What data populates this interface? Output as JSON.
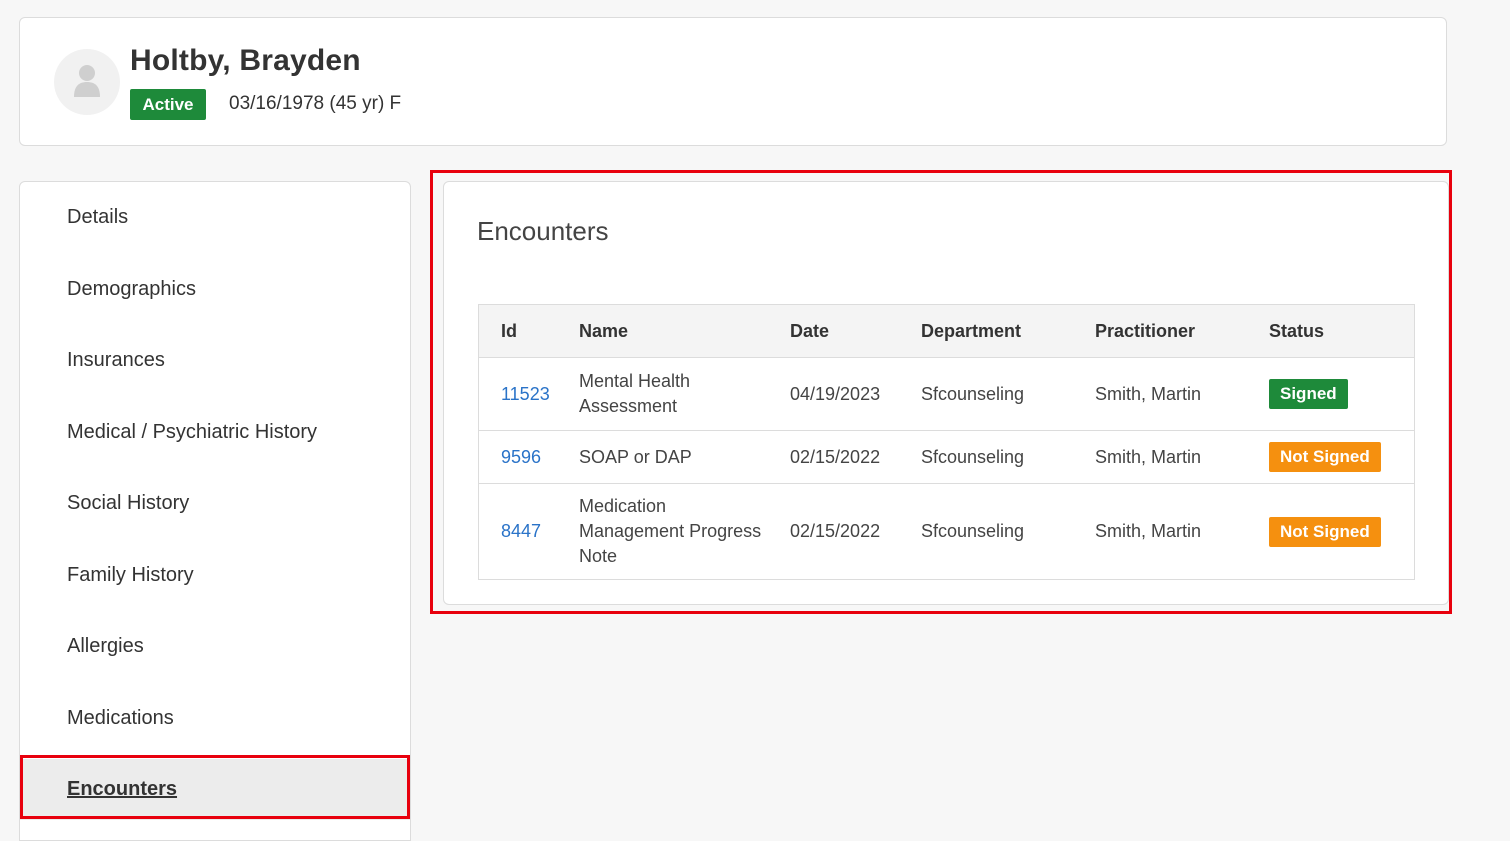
{
  "patient": {
    "name": "Holtby, Brayden",
    "status": "Active",
    "dob_line": "03/16/1978 (45 yr) F"
  },
  "sidebar": {
    "items": [
      {
        "label": "Details"
      },
      {
        "label": "Demographics"
      },
      {
        "label": "Insurances"
      },
      {
        "label": "Medical / Psychiatric History"
      },
      {
        "label": "Social History"
      },
      {
        "label": "Family History"
      },
      {
        "label": "Allergies"
      },
      {
        "label": "Medications"
      },
      {
        "label": "Encounters",
        "selected": true
      }
    ]
  },
  "encounters": {
    "title": "Encounters",
    "columns": [
      "Id",
      "Name",
      "Date",
      "Department",
      "Practitioner",
      "Status"
    ],
    "rows": [
      {
        "id": "11523",
        "name_lines": [
          "Mental Health",
          "Assessment"
        ],
        "date": "04/19/2023",
        "department": "Sfcounseling",
        "practitioner": "Smith, Martin",
        "status": "Signed"
      },
      {
        "id": "9596",
        "name_lines": [
          "SOAP or DAP"
        ],
        "date": "02/15/2022",
        "department": "Sfcounseling",
        "practitioner": "Smith, Martin",
        "status": "Not Signed"
      },
      {
        "id": "8447",
        "name_lines": [
          "Medication",
          "Management Progress",
          "Note"
        ],
        "date": "02/15/2022",
        "department": "Sfcounseling",
        "practitioner": "Smith, Martin",
        "status": "Not Signed"
      }
    ]
  },
  "colors": {
    "active_green": "#1e8a3a",
    "signed_green": "#1e8a3a",
    "not_signed_orange": "#f5900f",
    "link_blue": "#2a73c8",
    "highlight_red": "#e8000d"
  },
  "icons": {
    "avatar": "user-silhouette-icon"
  }
}
